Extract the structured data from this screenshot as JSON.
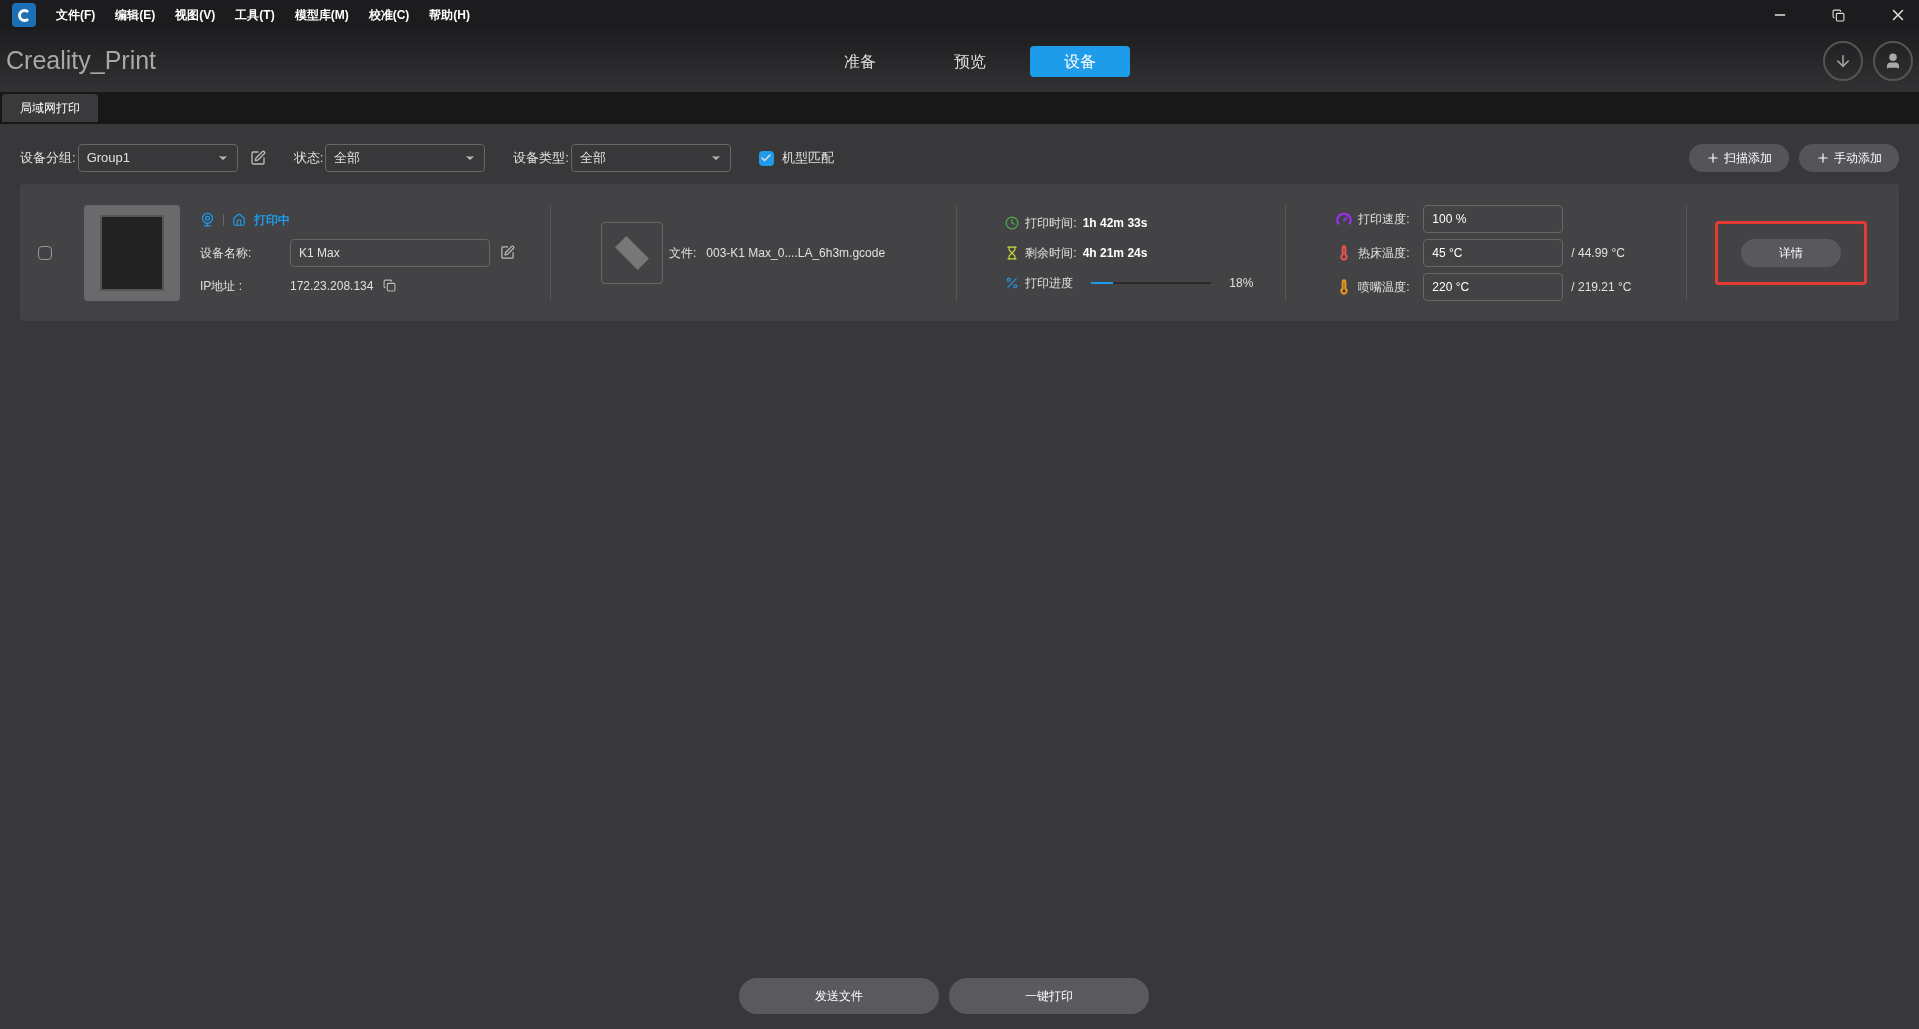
{
  "menu": [
    "文件(F)",
    "编辑(E)",
    "视图(V)",
    "工具(T)",
    "模型库(M)",
    "校准(C)",
    "帮助(H)"
  ],
  "app_title": "Creality_Print",
  "tabs": [
    {
      "label": "准备",
      "selected": false
    },
    {
      "label": "预览",
      "selected": false
    },
    {
      "label": "设备",
      "selected": true
    }
  ],
  "subtabs": [
    {
      "label": "局域网打印",
      "selected": true
    }
  ],
  "filters": [
    {
      "label": "设备分组:",
      "value": "Group1",
      "editable": true
    },
    {
      "label": "状态:",
      "value": "全部",
      "editable": false
    },
    {
      "label": "设备类型:",
      "value": "全部",
      "editable": false
    }
  ],
  "model_match": {
    "label": "机型匹配",
    "checked": true
  },
  "add_buttons": [
    "扫描添加",
    "手动添加"
  ],
  "device": {
    "selected": false,
    "status": "打印中",
    "name_label": "设备名称:",
    "name": "K1 Max",
    "ip_label": "IP地址 :",
    "ip": "172.23.208.134",
    "file_label": "文件:",
    "file": "003-K1 Max_0....LA_6h3m.gcode",
    "print_time_label": "打印时间:",
    "print_time": "1h 42m 33s",
    "remaining_label": "剩余时间:",
    "remaining": "4h 21m 24s",
    "progress_label": "打印进度",
    "level": 0.18,
    "progress": "18%",
    "params": [
      {
        "kind": "speed",
        "label": "打印速度:",
        "value": "100 %",
        "color": "#9b30ff"
      },
      {
        "kind": "bed",
        "label": "热床温度:",
        "value": "45 °C",
        "actual": "/ 44.99 °C",
        "color": "#ef5350"
      },
      {
        "kind": "nozzle",
        "label": "喷嘴温度:",
        "value": "220 °C",
        "actual": "/ 219.21 °C",
        "color": "#f09a1a"
      }
    ],
    "details": {
      "label": "详情",
      "highlighted": true
    }
  },
  "bottom_buttons": [
    "发送文件",
    "一键打印"
  ]
}
